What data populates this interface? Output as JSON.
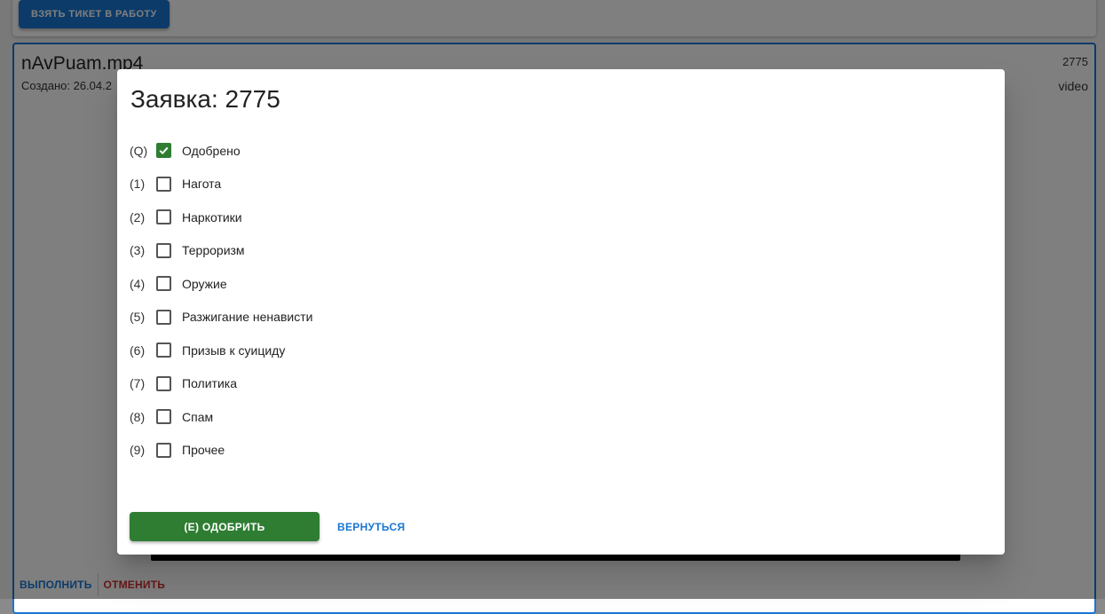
{
  "background": {
    "take_ticket_label": "ВЗЯТЬ ТИКЕТ В РАБОТУ",
    "ticket": {
      "file_name": "nAvPuam.mp4",
      "created_text": "Создано: 26.04.2",
      "number": "2775",
      "type": "video",
      "execute_label": "ВЫПОЛНИТЬ",
      "cancel_label": "ОТМЕНИТЬ"
    }
  },
  "dialog": {
    "title": "Заявка: 2775",
    "options": [
      {
        "key": "(Q)",
        "label": "Одобрено",
        "checked": true
      },
      {
        "key": "(1)",
        "label": "Нагота",
        "checked": false
      },
      {
        "key": "(2)",
        "label": "Наркотики",
        "checked": false
      },
      {
        "key": "(3)",
        "label": "Терроризм",
        "checked": false
      },
      {
        "key": "(4)",
        "label": "Оружие",
        "checked": false
      },
      {
        "key": "(5)",
        "label": "Разжигание ненависти",
        "checked": false
      },
      {
        "key": "(6)",
        "label": "Призыв к суициду",
        "checked": false
      },
      {
        "key": "(7)",
        "label": "Политика",
        "checked": false
      },
      {
        "key": "(8)",
        "label": "Спам",
        "checked": false
      },
      {
        "key": "(9)",
        "label": "Прочее",
        "checked": false
      }
    ],
    "approve_label": "(E) ОДОБРИТЬ",
    "back_label": "ВЕРНУТЬСЯ"
  },
  "colors": {
    "primary": "#1976d2",
    "success": "#2e7d32",
    "danger": "#d32f2f"
  },
  "icons": {
    "checked": "check-icon"
  }
}
